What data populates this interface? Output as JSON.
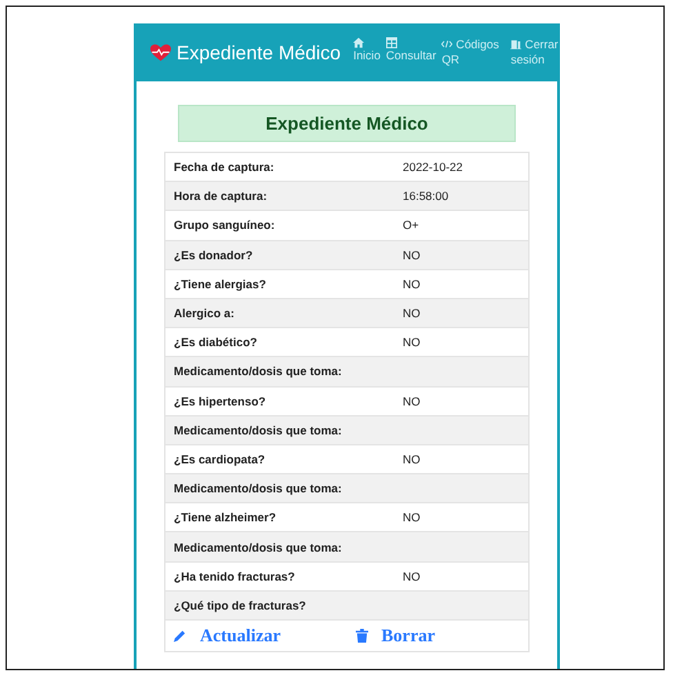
{
  "navbar": {
    "brand": "Expediente Médico",
    "items": [
      {
        "kind": "home",
        "label": "Inicio"
      },
      {
        "kind": "table",
        "label": "Consultar"
      },
      {
        "kind": "code",
        "label": "Códigos QR"
      },
      {
        "kind": "door",
        "label": "Cerrar sesión"
      }
    ]
  },
  "heading": "Expediente Médico",
  "rows": [
    {
      "label": "Fecha de captura:",
      "value": "2022-10-22"
    },
    {
      "label": "Hora de captura:",
      "value": "16:58:00"
    },
    {
      "label": "Grupo sanguíneo:",
      "value": "O+"
    },
    {
      "label": "¿Es donador?",
      "value": "NO"
    },
    {
      "label": "¿Tiene alergias?",
      "value": "NO"
    },
    {
      "label": "Alergico a:",
      "value": "NO"
    },
    {
      "label": "¿Es diabético?",
      "value": "NO"
    },
    {
      "label": "Medicamento/dosis que toma:"
    },
    {
      "label": "¿Es hipertenso?",
      "value": "NO"
    },
    {
      "label": "Medicamento/dosis que toma:"
    },
    {
      "label": "¿Es cardiopata?",
      "value": "NO"
    },
    {
      "label": "Medicamento/dosis que toma:"
    },
    {
      "label": "¿Tiene alzheimer?",
      "value": "NO"
    },
    {
      "label": "Medicamento/dosis que toma:"
    },
    {
      "label": "¿Ha tenido fracturas?",
      "value": "NO"
    },
    {
      "label": "¿Qué tipo de fracturas?"
    }
  ],
  "actions": [
    {
      "kind": "edit",
      "label": "Actualizar"
    },
    {
      "kind": "delete",
      "label": "Borrar"
    }
  ]
}
